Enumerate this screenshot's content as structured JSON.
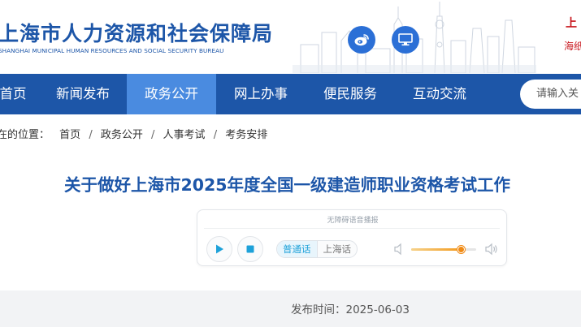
{
  "header": {
    "logo_cn": "上海市人力资源和社会保障局",
    "logo_en": "SHANGHAI MUNICIPAL HUMAN RESOURCES AND SOCIAL SECURITY BUREAU",
    "weibo_icon": "weibo-icon",
    "pc_icon": "desktop-icon",
    "right_tag_a": "上",
    "right_tag_b": "海纸"
  },
  "nav": {
    "items": [
      {
        "label": "首页"
      },
      {
        "label": "新闻发布"
      },
      {
        "label": "政务公开"
      },
      {
        "label": "网上办事"
      },
      {
        "label": "便民服务"
      },
      {
        "label": "互动交流"
      }
    ],
    "active_index": 2,
    "search_placeholder": "请输入关"
  },
  "breadcrumb": {
    "prefix": "在的位置：",
    "items": [
      "首页",
      "政务公开",
      "人事考试",
      "考务安排"
    ],
    "separator": "/"
  },
  "article": {
    "title": "关于做好上海市2025年度全国一级建造师职业资格考试工作"
  },
  "player": {
    "label": "无障碍语音播报",
    "play_icon": "play-icon",
    "stop_icon": "stop-icon",
    "dialects": [
      "普通话",
      "上海话"
    ],
    "selected_dialect": "普通话",
    "volume_percent": 78,
    "accent_color": "#1da1d9",
    "volume_color": "#f08a14"
  },
  "meta": {
    "publish_time": "发布时间：2025-06-03"
  },
  "colors": {
    "brand_blue": "#1d56a8",
    "nav_active": "#4a8be0",
    "alert_red": "#c8161d"
  }
}
